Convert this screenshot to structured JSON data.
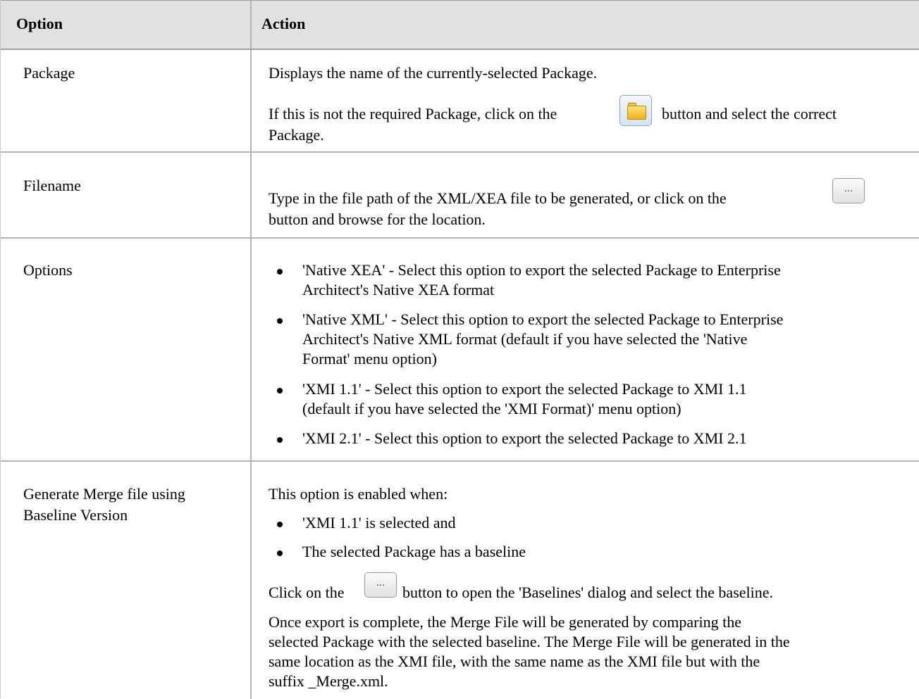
{
  "header": {
    "option": "Option",
    "action": "Action"
  },
  "rows": {
    "package": {
      "option": "Package",
      "line1": "Displays the name of the currently-selected Package.",
      "line2a": "If this is not the required Package, click on the",
      "line2b": "button and select the correct",
      "line3": "Package.",
      "icon": "folder-browse-icon"
    },
    "filename": {
      "option": "Filename",
      "line1a": "Type in the file path of the XML/XEA file to be generated, or click on the",
      "line2": "button and browse for the location.",
      "button_label": "..."
    },
    "options": {
      "option": "Options",
      "b1l1": "'Native XEA' - Select this option to export the selected Package to Enterprise",
      "b1l2": "Architect's Native XEA format",
      "b2l1": "'Native XML' - Select this option to export the selected Package to Enterprise",
      "b2l2": "Architect's Native XML format (default if you have selected the 'Native",
      "b2l3": "Format' menu option)",
      "b3l1": "'XMI 1.1' - Select this option to export the selected Package to XMI 1.1",
      "b3l2": "(default if you have selected the 'XMI Format)' menu option)",
      "b4l1": "'XMI 2.1' - Select this option to export the selected Package to XMI 2.1"
    },
    "merge": {
      "option_l1": "Generate Merge file using",
      "option_l2": "Baseline Version",
      "intro": "This option is enabled when:",
      "b1": "'XMI 1.1' is selected and",
      "b2": "The selected Package has a baseline",
      "click_a": "Click on the",
      "click_b": "button to open the 'Baselines' dialog and select the baseline.",
      "button_label": "...",
      "p1": "Once export is complete, the Merge File will be generated by comparing the",
      "p2": "selected Package with the selected baseline. The Merge File will be generated in the",
      "p3": "same location as the XMI file, with the same name as the XMI file but with the",
      "p4": "suffix _Merge.xml."
    }
  }
}
